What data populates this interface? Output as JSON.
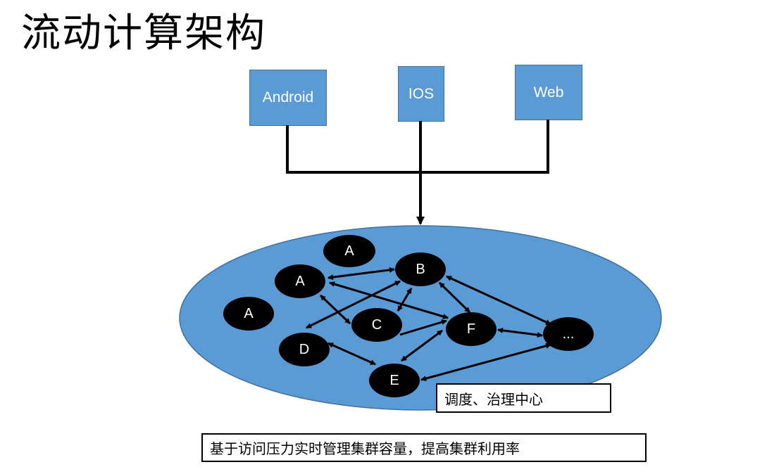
{
  "title": "流动计算架构",
  "clients": [
    {
      "label": "Android"
    },
    {
      "label": "IOS"
    },
    {
      "label": "Web"
    }
  ],
  "colors": {
    "client_fill": "#5b9bd5",
    "cluster_fill": "#5b9bd5",
    "node_fill": "#000000",
    "node_text": "#ffffff",
    "connector": "#000000"
  },
  "nodes": {
    "a_top": "A",
    "a_main": "A",
    "a_left": "A",
    "b": "B",
    "c": "C",
    "d": "D",
    "e": "E",
    "f": "F",
    "more": "..."
  },
  "center_label": "调度、治理中心",
  "bottom_caption": "基于访问压力实时管理集群容量，提高集群利用率"
}
